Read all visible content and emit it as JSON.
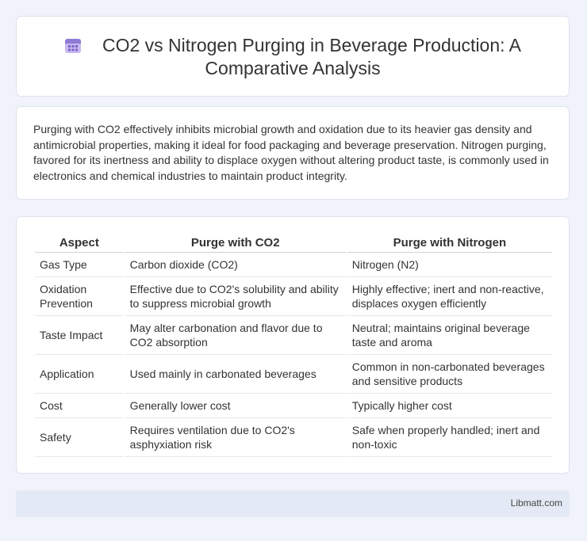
{
  "header": {
    "title": "CO2 vs Nitrogen Purging in Beverage Production: A Comparative Analysis",
    "icon": "calendar-icon"
  },
  "intro": {
    "text": "Purging with CO2 effectively inhibits microbial growth and oxidation due to its heavier gas density and antimicrobial properties, making it ideal for food packaging and beverage preservation. Nitrogen purging, favored for its inertness and ability to displace oxygen without altering product taste, is commonly used in electronics and chemical industries to maintain product integrity."
  },
  "table": {
    "headers": [
      "Aspect",
      "Purge with CO2",
      "Purge with Nitrogen"
    ],
    "rows": [
      [
        "Gas Type",
        "Carbon dioxide (CO2)",
        "Nitrogen (N2)"
      ],
      [
        "Oxidation Prevention",
        "Effective due to CO2's solubility and ability to suppress microbial growth",
        "Highly effective; inert and non-reactive, displaces oxygen efficiently"
      ],
      [
        "Taste Impact",
        "May alter carbonation and flavor due to CO2 absorption",
        "Neutral; maintains original beverage taste and aroma"
      ],
      [
        "Application",
        "Used mainly in carbonated beverages",
        "Common in non-carbonated beverages and sensitive products"
      ],
      [
        "Cost",
        "Generally lower cost",
        "Typically higher cost"
      ],
      [
        "Safety",
        "Requires ventilation due to CO2's asphyxiation risk",
        "Safe when properly handled; inert and non-toxic"
      ]
    ]
  },
  "footer": {
    "brand": "Libmatt.com"
  }
}
